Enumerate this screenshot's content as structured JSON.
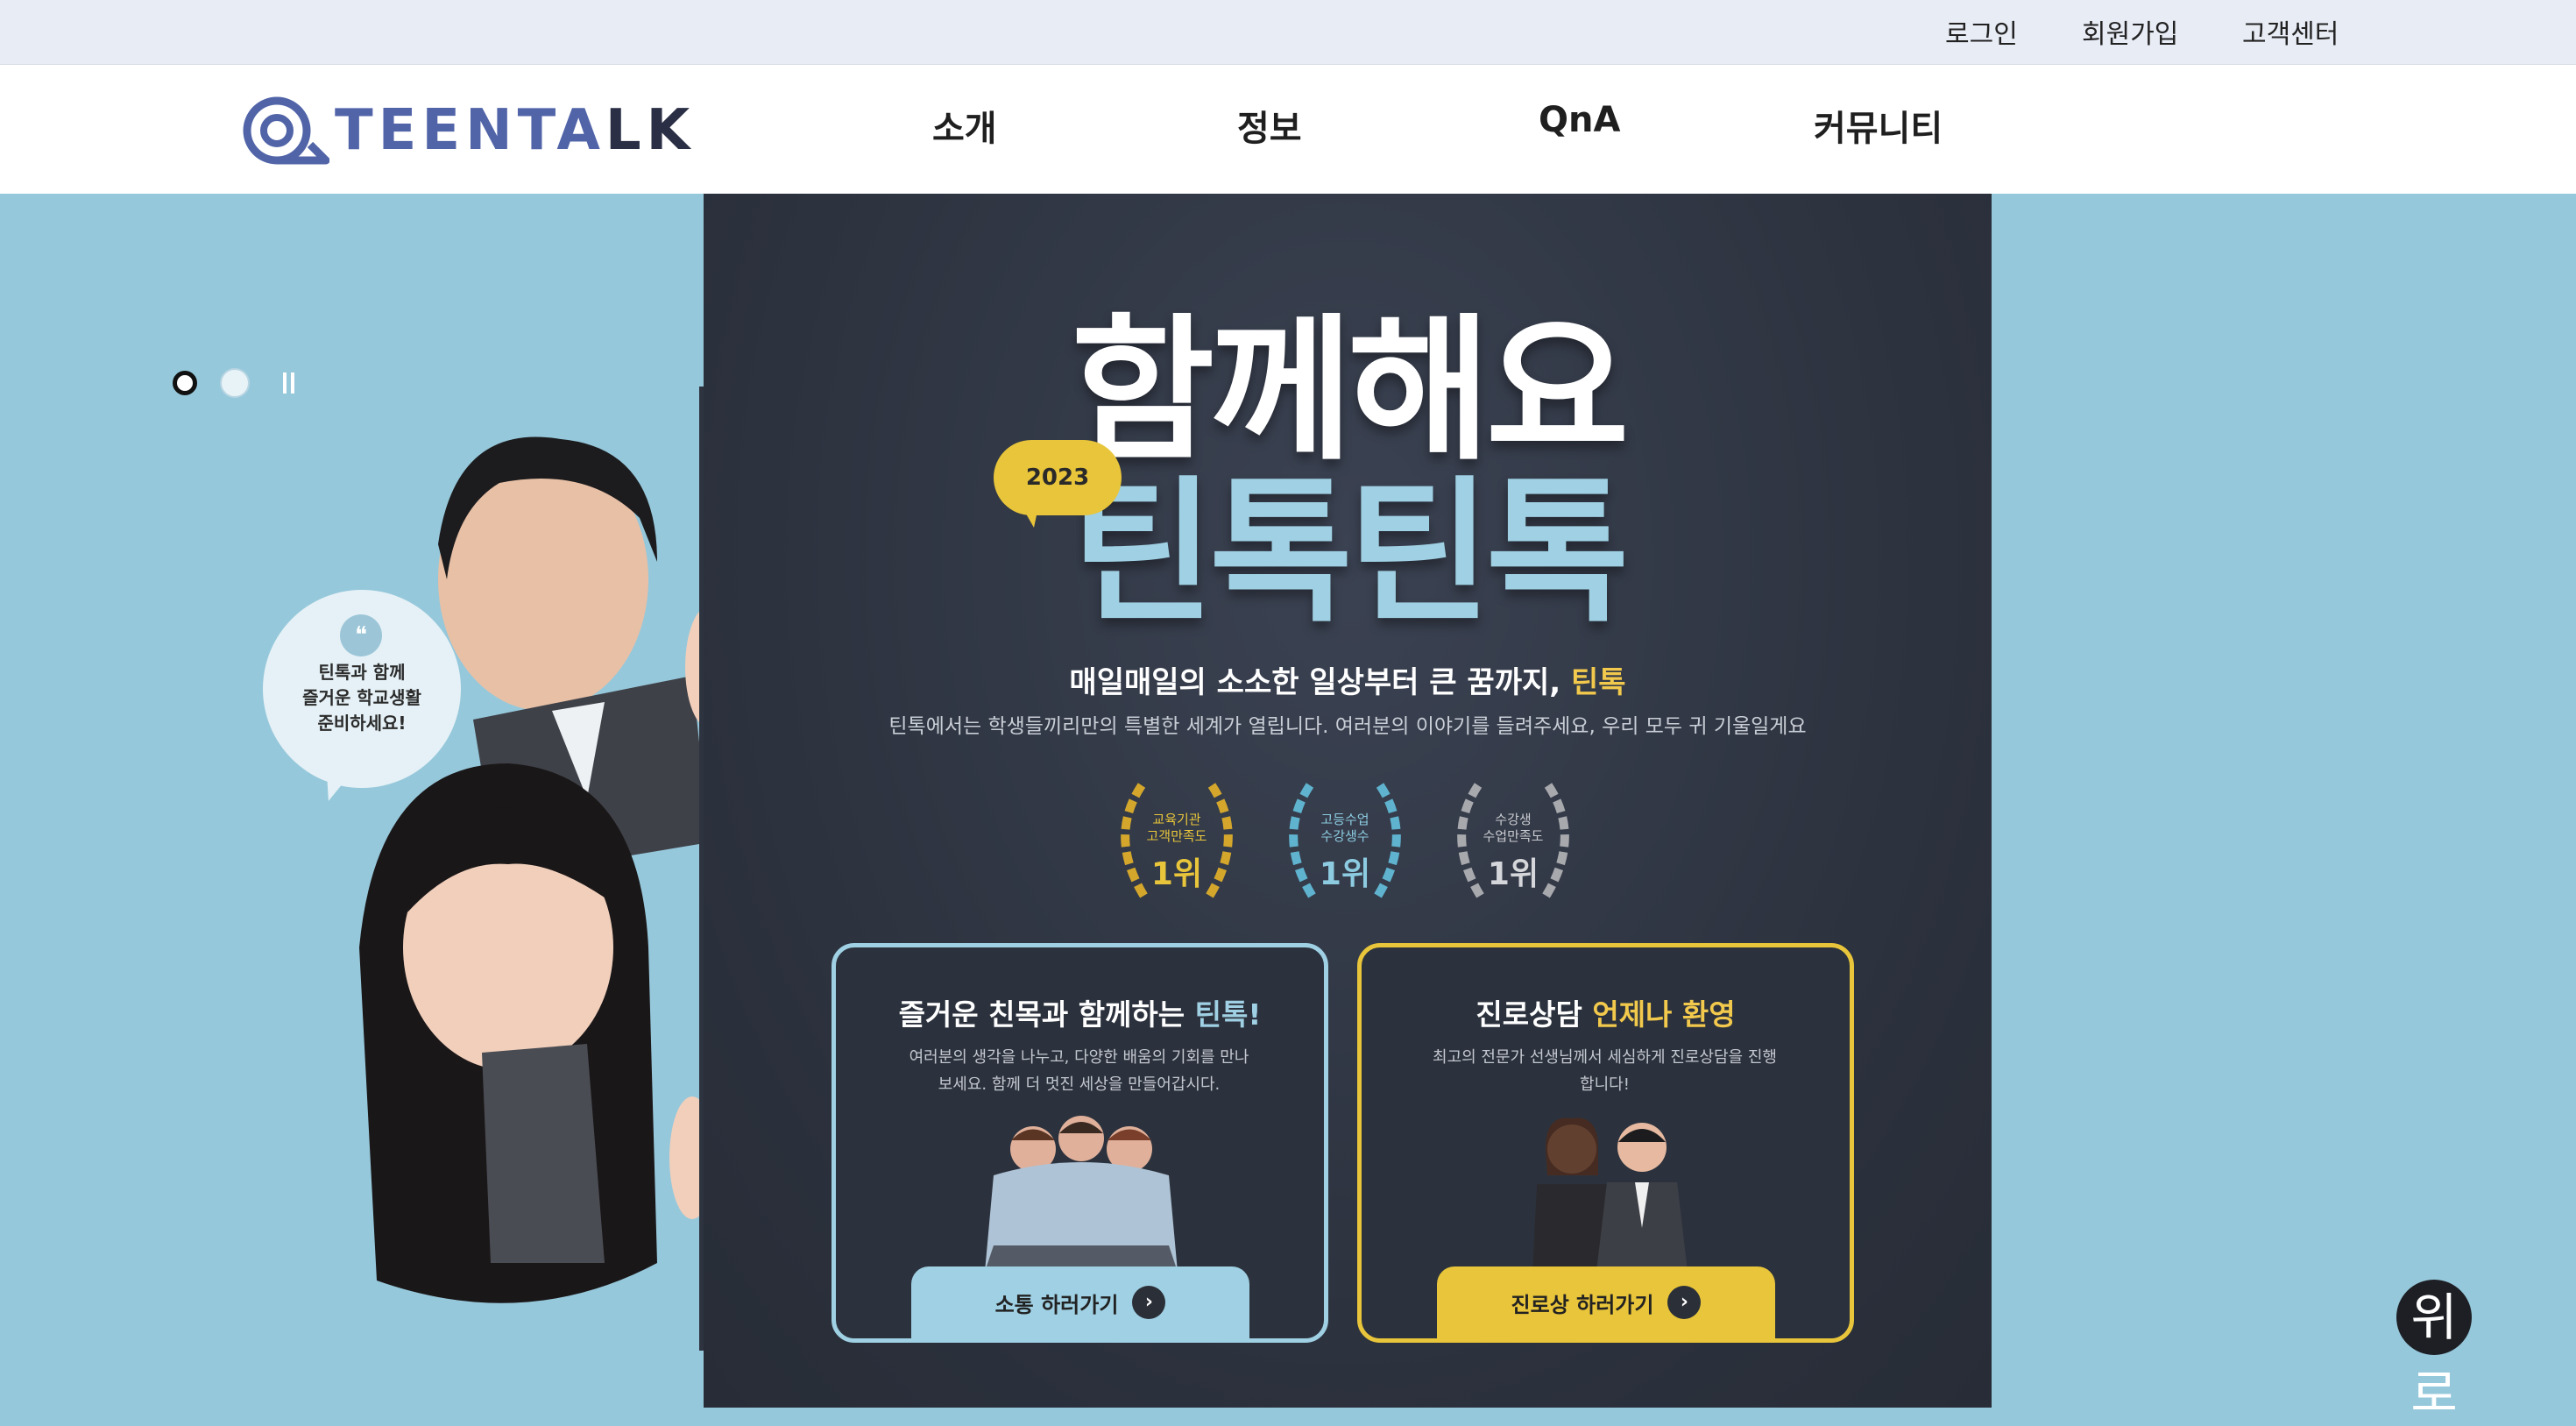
{
  "topbar": {
    "links": [
      "로그인",
      "회원가입",
      "고객센터"
    ]
  },
  "header": {
    "logo": {
      "text_main": "TEENTA",
      "text_dark": "LK"
    },
    "nav": [
      "소개",
      "정보",
      "QnA",
      "커뮤니티"
    ]
  },
  "hero": {
    "slider": {
      "active_index": 0,
      "count": 2
    },
    "bubble_text": "틴톡과 함께\n즐거운 학교생활\n준비하세요!",
    "year_badge": "2023",
    "headline_line1": "함께해요",
    "headline_line2": "틴톡틴톡",
    "slogan_prefix": "매일매일의 소소한 일상부터 큰 꿈까지,",
    "slogan_highlight": "틴톡",
    "description": "틴톡에서는 학생들끼리만의 특별한 세계가 열립니다. 여러분의 이야기를 들려주세요, 우리 모두 귀 기울일게요",
    "awards": [
      {
        "label": "교육기관\n고객만족도",
        "rank": "1위",
        "color": "#d4a72c"
      },
      {
        "label": "고등수업\n수강생수",
        "rank": "1위",
        "color": "#5fb3cf"
      },
      {
        "label": "수강생\n수업만족도",
        "rank": "1위",
        "color": "#a7a9ad"
      }
    ],
    "cards": [
      {
        "title_prefix": "즐거운 친목과 함께하는",
        "title_highlight": "틴톡!",
        "description": "여러분의 생각을 나누고, 다양한 배움의 기회를 만나보세요. 함께 더 멋진 세상을 만들어갑시다.",
        "button": "소통 하러가기",
        "accent": "#9fd0e3"
      },
      {
        "title_prefix": "진로상담",
        "title_highlight": "언제나 환영",
        "description": "최고의 전문가 선생님께서 세심하게 진로상담을 진행합니다!",
        "button": "진로상 하러가기",
        "accent": "#e8c53a"
      }
    ]
  },
  "to_top": {
    "label": "위",
    "sub": "로"
  },
  "colors": {
    "hero_bg": "#96c8db",
    "panel_bg": "#2d333f",
    "brand": "#5164a8",
    "yellow": "#e8c53a",
    "sky": "#9fd0e3"
  }
}
